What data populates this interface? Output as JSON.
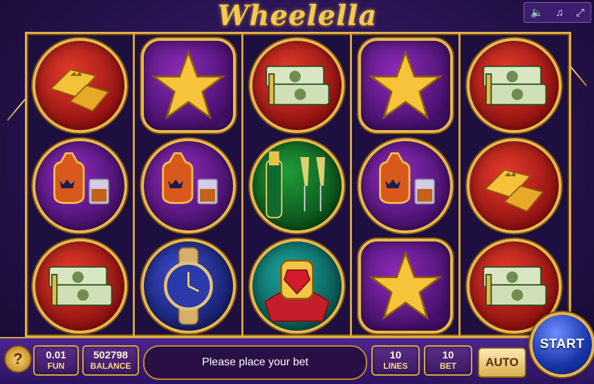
{
  "game": {
    "title": "Wheelella",
    "message": "Please place your bet",
    "colors": {
      "gold": "#e2b04b",
      "accent_purple": "#4a2490",
      "start_blue": "#1735a8"
    }
  },
  "top_controls": [
    {
      "name": "sound",
      "icon": "speaker-icon",
      "glyph": "🔈"
    },
    {
      "name": "music",
      "icon": "music-note-icon",
      "glyph": "♫"
    },
    {
      "name": "fullscreen",
      "icon": "fullscreen-icon",
      "glyph": "⤢"
    }
  ],
  "reels": [
    [
      "gold-bars",
      "cognac",
      "cash-stack"
    ],
    [
      "star",
      "cognac",
      "watch"
    ],
    [
      "cash-stack",
      "champagne",
      "ring"
    ],
    [
      "star",
      "cognac",
      "star"
    ],
    [
      "cash-stack",
      "gold-bars",
      "cash-stack"
    ]
  ],
  "bottom": {
    "help_label": "?",
    "coin": {
      "value": "0.01",
      "label": "FUN"
    },
    "balance": {
      "value": "502798",
      "label": "BALANCE"
    },
    "lines": {
      "value": "10",
      "label": "LINES"
    },
    "bet": {
      "value": "10",
      "label": "BET"
    },
    "auto_label": "AUTO",
    "start_label": "START"
  }
}
